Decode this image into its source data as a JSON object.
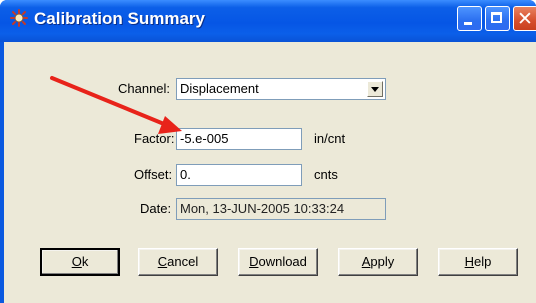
{
  "window": {
    "title": "Calibration Summary",
    "controls": {
      "minimize_icon": "minimize-icon",
      "maximize_icon": "maximize-icon",
      "close_icon": "close-icon"
    }
  },
  "form": {
    "channel": {
      "label": "Channel:",
      "value": "Displacement"
    },
    "factor": {
      "label": "Factor:",
      "value": "-5.e-005",
      "unit": "in/cnt"
    },
    "offset": {
      "label": "Offset:",
      "value": "0.",
      "unit": "cnts"
    },
    "date": {
      "label": "Date:",
      "value": "Mon, 13-JUN-2005 10:33:24"
    }
  },
  "buttons": [
    {
      "key": "O",
      "rest": "k"
    },
    {
      "key": "C",
      "rest": "ancel"
    },
    {
      "key": "D",
      "rest": "ownload"
    },
    {
      "key": "A",
      "rest": "pply"
    },
    {
      "key": "H",
      "rest": "elp"
    }
  ],
  "annotation": {
    "arrow_color": "#e8231a"
  }
}
